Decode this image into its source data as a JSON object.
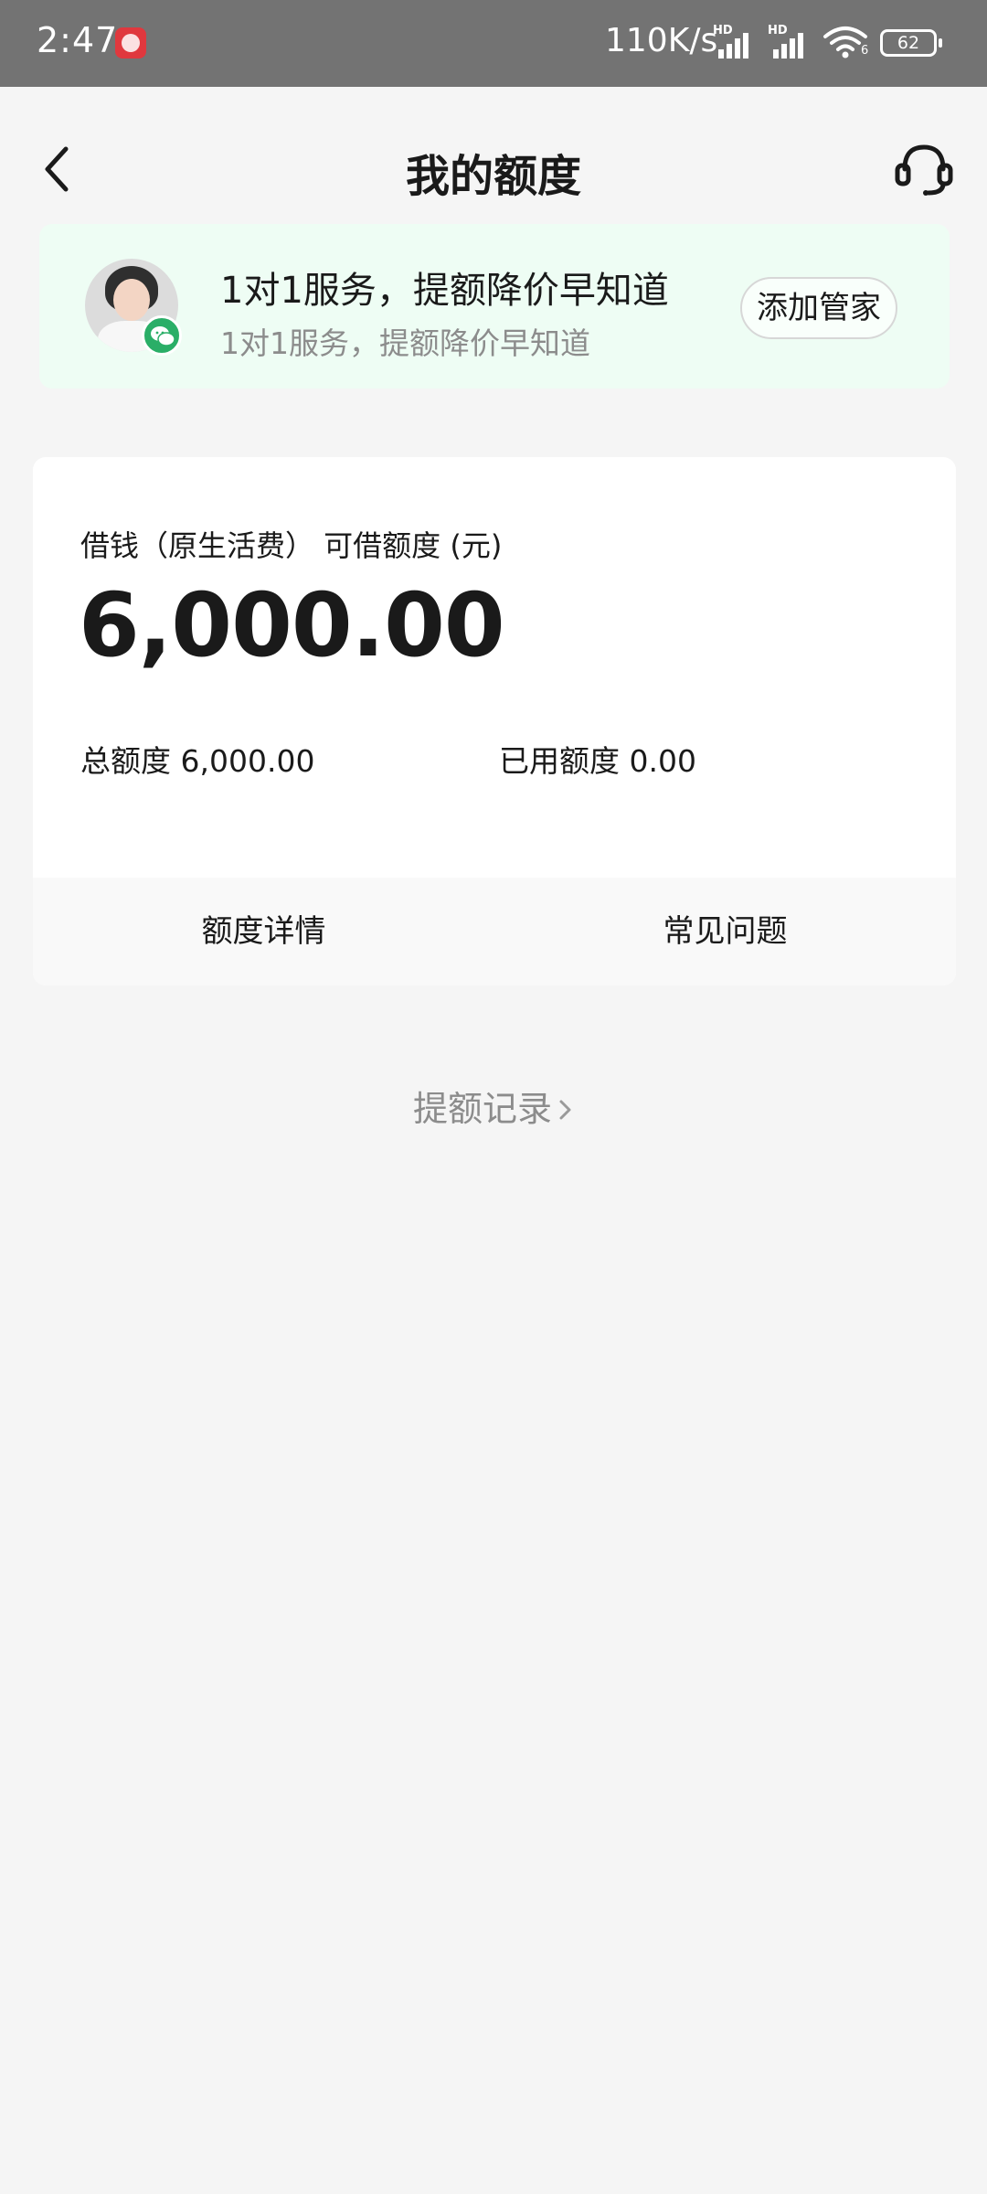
{
  "status_bar": {
    "time": "2:47",
    "net_speed": "110K/s",
    "signal_label": "HD",
    "wifi_sub": "6",
    "battery": "62"
  },
  "header": {
    "title": "我的额度"
  },
  "promo": {
    "title": "1对1服务，提额降价早知道",
    "subtitle": "1对1服务，提额降价早知道",
    "button_label": "添加管家"
  },
  "quota": {
    "label": "借钱（原生活费） 可借额度 (元)",
    "amount": "6,000.00",
    "total_label": "总额度",
    "total_value": "6,000.00",
    "used_label": "已用额度",
    "used_value": "0.00",
    "actions": [
      {
        "label": "额度详情"
      },
      {
        "label": "常见问题"
      }
    ]
  },
  "record_link": {
    "label": "提额记录"
  }
}
